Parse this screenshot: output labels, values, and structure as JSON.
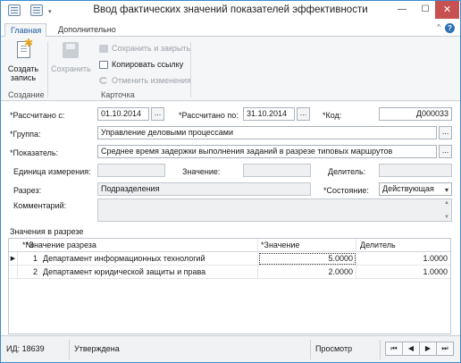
{
  "window": {
    "title": "Ввод фактических значений показателей эффективности",
    "min_glyph": "—",
    "max_glyph": "☐",
    "close_glyph": "✕"
  },
  "ribbon": {
    "tabs": [
      {
        "label": "Главная",
        "active": true
      },
      {
        "label": "Дополнительно",
        "active": false
      }
    ],
    "help_glyph": "?",
    "collapse_glyph": "^",
    "create_label_line1": "Создать",
    "create_label_line2": "запись",
    "save_label": "Сохранить",
    "save_close_label": "Сохранить и закрыть",
    "copy_link_label": "Копировать ссылку",
    "undo_label": "Отменить изменения",
    "group_create": "Создание",
    "group_card": "Карточка"
  },
  "form": {
    "calc_from_label": "*Рассчитано с:",
    "calc_from_value": "01.10.2014",
    "calc_to_label": "*Рассчитано по:",
    "calc_to_value": "31.10.2014",
    "code_label": "*Код:",
    "code_value": "Д000033",
    "group_label": "*Группа:",
    "group_value": "Управление деловыми процессами",
    "indicator_label": "*Показатель:",
    "indicator_value": "Среднее время задержки выполнения заданий в разрезе типовых маршрутов",
    "unit_label": "Единица измерения:",
    "unit_value": "",
    "value_label": "Значение:",
    "value_value": "",
    "divisor_label": "Делитель:",
    "divisor_value": "",
    "slice_label": "Разрез:",
    "slice_value": "Подразделения",
    "state_label": "*Состояние:",
    "state_value": "Действующая",
    "comment_label": "Комментарий:",
    "comment_value": "",
    "dots_glyph": "...",
    "caret_glyph": "▾"
  },
  "table": {
    "title": "Значения в разрезе",
    "columns": [
      "*№",
      "*Значение разреза",
      "*Значение",
      "Делитель"
    ],
    "rows": [
      {
        "num": "1",
        "slice": "Департамент информационных технологий",
        "value": "5.0000",
        "divisor": "1.0000",
        "current": true
      },
      {
        "num": "2",
        "slice": "Департамент юридической защиты и права",
        "value": "2.0000",
        "divisor": "1.0000",
        "current": false
      }
    ],
    "current_row_glyph": "▶"
  },
  "status": {
    "id_text": "ИД: 18639",
    "state_text": "Утверждена",
    "mode_text": "Просмотр",
    "nav": [
      "⏮",
      "◀",
      "▶",
      "⏭"
    ]
  }
}
